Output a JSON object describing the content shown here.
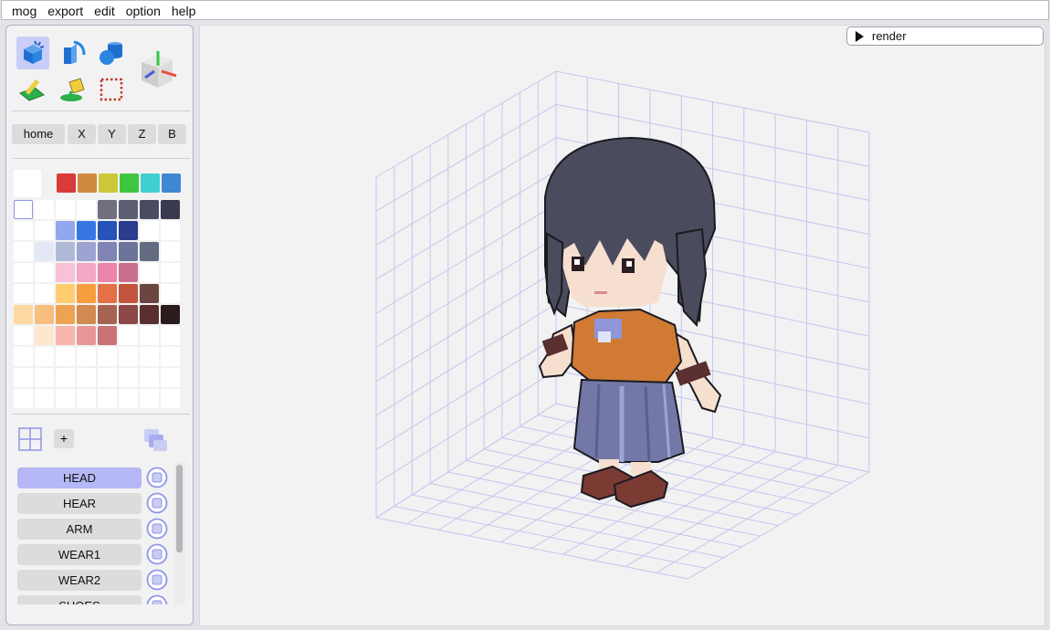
{
  "menu": [
    "mog",
    "export",
    "edit",
    "option",
    "help"
  ],
  "tools": [
    {
      "name": "voxel-add-icon",
      "active": true
    },
    {
      "name": "paint-bucket-shape-icon",
      "active": false
    },
    {
      "name": "solid-shapes-icon",
      "active": false
    },
    {
      "name": "pencil-color-icon",
      "active": false
    },
    {
      "name": "fill-color-icon",
      "active": false
    },
    {
      "name": "select-region-icon",
      "active": false
    }
  ],
  "axis_buttons": [
    "home",
    "X",
    "Y",
    "Z",
    "B"
  ],
  "palette_top": [
    "#d93a3a",
    "#cf8a3e",
    "#cdc73a",
    "#3fc53f",
    "#3fcfcf",
    "#3f86d3"
  ],
  "palette_rows": [
    [
      "#ffffff-sel",
      "#ffffff",
      "#ffffff",
      "#ffffff",
      "#6f6f80",
      "#5d5f72",
      "#4a4c62",
      "#393a4f"
    ],
    [
      "#ffffff",
      "#ffffff",
      "#91a8ef",
      "#3777e3",
      "#2853b6",
      "#2a3d8e",
      "#ffffff",
      "#ffffff"
    ],
    [
      "#ffffff",
      "#e3e8f5",
      "#b0b9d6",
      "#9ea3d1",
      "#8085b5",
      "#6c7599",
      "#636b80",
      "#ffffff"
    ],
    [
      "#ffffff",
      "#ffffff",
      "#f7c2d8",
      "#f3a6c6",
      "#ec84ad",
      "#c96f8e",
      "#ffffff",
      "#ffffff"
    ],
    [
      "#ffffff",
      "#ffffff",
      "#ffcd70",
      "#f89d3d",
      "#e47045",
      "#c2553e",
      "#6b4640",
      "#ffffff"
    ],
    [
      "#ffd9a4",
      "#f8be80",
      "#eea352",
      "#d18a4f",
      "#a6634f",
      "#8c4747",
      "#5a2f2f",
      "#2a1b1c"
    ],
    [
      "#ffffff",
      "#ffe7cd",
      "#f9b6ad",
      "#e79797",
      "#c97379",
      "#ffffff",
      "#ffffff",
      "#ffffff"
    ],
    [
      "#ffffff",
      "#ffffff",
      "#ffffff",
      "#ffffff",
      "#ffffff",
      "#ffffff",
      "#ffffff",
      "#ffffff"
    ],
    [
      "#ffffff",
      "#ffffff",
      "#ffffff",
      "#ffffff",
      "#ffffff",
      "#ffffff",
      "#ffffff",
      "#ffffff"
    ],
    [
      "#ffffff",
      "#ffffff",
      "#ffffff",
      "#ffffff",
      "#ffffff",
      "#ffffff",
      "#ffffff",
      "#ffffff"
    ]
  ],
  "layer_controls": {
    "add_label": "+"
  },
  "layers": [
    {
      "label": "HEAD",
      "active": true
    },
    {
      "label": "HEAR",
      "active": false
    },
    {
      "label": "ARM",
      "active": false
    },
    {
      "label": "WEAR1",
      "active": false
    },
    {
      "label": "WEAR2",
      "active": false
    },
    {
      "label": "SHOES",
      "active": false
    }
  ],
  "render_button": "render",
  "colors": {
    "accent": "#b5b8f4",
    "grid": "#c4c6f0",
    "hair": "#4a4b5c",
    "skin": "#f7dfcf",
    "shirt": "#d07a34",
    "skirt": "#7378a7",
    "shoes": "#7a3b33"
  }
}
